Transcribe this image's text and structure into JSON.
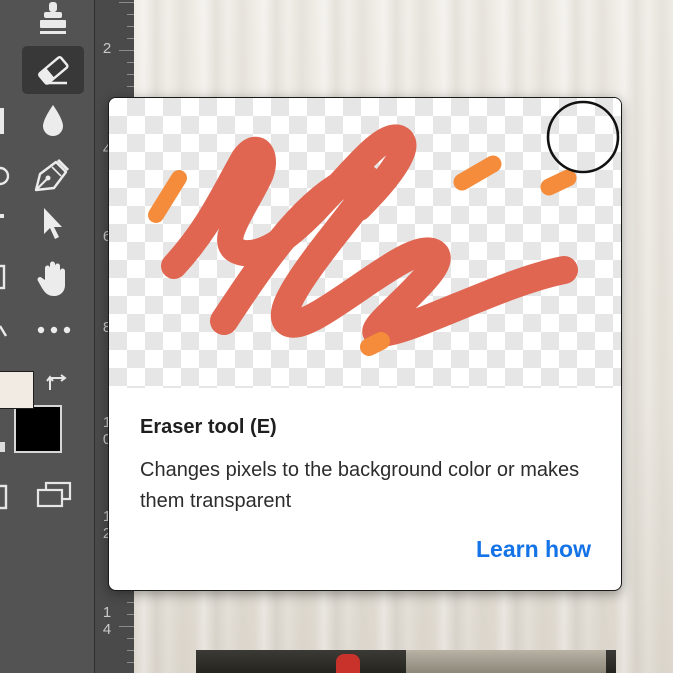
{
  "tooltip": {
    "title": "Eraser tool (E)",
    "description": "Changes pixels to the background color or makes them transparent",
    "link_label": "Learn how"
  },
  "ruler": {
    "labels": [
      "2",
      "4",
      "6",
      "8",
      "1\n0",
      "1\n2",
      "1\n4"
    ]
  },
  "colors": {
    "foreground": "#f1ebe3",
    "background": "#000000",
    "stroke": "#e06651",
    "accent_dots": "#f48c3c",
    "link": "#1473e6",
    "toolbar": "#535353"
  },
  "toolbar": {
    "tools": [
      "stamp-icon",
      "eraser-icon",
      "blur-drop-icon",
      "pen-icon",
      "path-select-icon",
      "hand-icon",
      "more-tools-icon",
      "swap-colors-icon",
      "screen-mode-icon"
    ],
    "active_tool": "eraser-icon"
  }
}
